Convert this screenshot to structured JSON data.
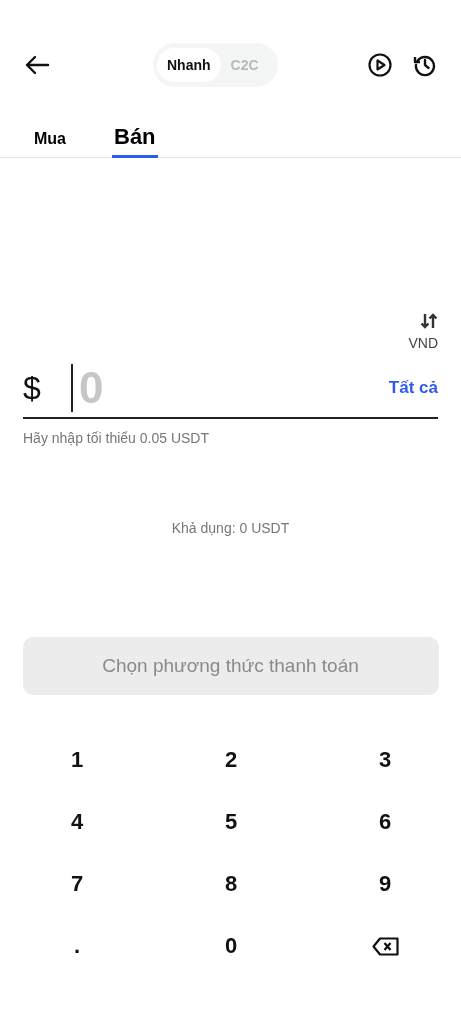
{
  "mode_switch": [
    {
      "label": "Nhanh",
      "selected": true
    },
    {
      "label": "C2C",
      "selected": false
    }
  ],
  "tabs": [
    {
      "label": "Mua",
      "selected": false
    },
    {
      "label": "Bán",
      "selected": true
    }
  ],
  "currency_toggle": {
    "label": "VND"
  },
  "amount": {
    "symbol": "$",
    "placeholder": "0",
    "max_link": "Tất cả"
  },
  "hint": "Hãy nhập tối thiểu 0.05 USDT",
  "available": "Khả dụng: 0 USDT",
  "submit": {
    "label": "Chọn phương thức thanh toán",
    "disabled": true
  },
  "keypad": [
    {
      "kind": "key",
      "label": "1"
    },
    {
      "kind": "key",
      "label": "2"
    },
    {
      "kind": "key",
      "label": "3"
    },
    {
      "kind": "key",
      "label": "4"
    },
    {
      "kind": "key",
      "label": "5"
    },
    {
      "kind": "key",
      "label": "6"
    },
    {
      "kind": "key",
      "label": "7"
    },
    {
      "kind": "key",
      "label": "8"
    },
    {
      "kind": "key",
      "label": "9"
    },
    {
      "kind": "key",
      "label": "."
    },
    {
      "kind": "key",
      "label": "0"
    },
    {
      "kind": "backspace"
    }
  ]
}
